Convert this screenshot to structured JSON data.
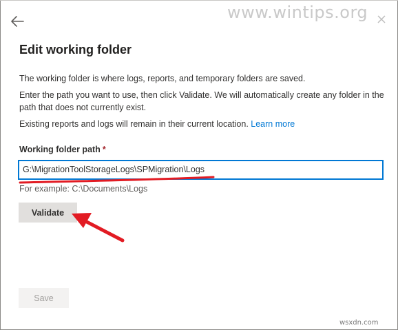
{
  "header": {
    "back_icon": "arrow-left-icon",
    "close_icon": "close-icon",
    "watermark": "www.wintips.org"
  },
  "dialog": {
    "title": "Edit working folder",
    "description_1": "The working folder is where logs, reports, and temporary folders are saved.",
    "description_2": "Enter the path you want to use, then click Validate. We will automatically create any folder in the path that does not currently exist.",
    "description_3": "Existing reports and logs will remain in their current location.",
    "learn_more": "Learn more"
  },
  "form": {
    "label": "Working folder path",
    "required_mark": "*",
    "path_value": "G:\\MigrationToolStorageLogs\\SPMigration\\Logs",
    "example": "For example: C:\\Documents\\Logs",
    "validate_label": "Validate",
    "save_label": "Save"
  },
  "footer": {
    "corner_watermark": "wsxdn.com"
  },
  "colors": {
    "accent": "#0078d4",
    "annotation_red": "#e21b23",
    "required_red": "#a4262c"
  }
}
